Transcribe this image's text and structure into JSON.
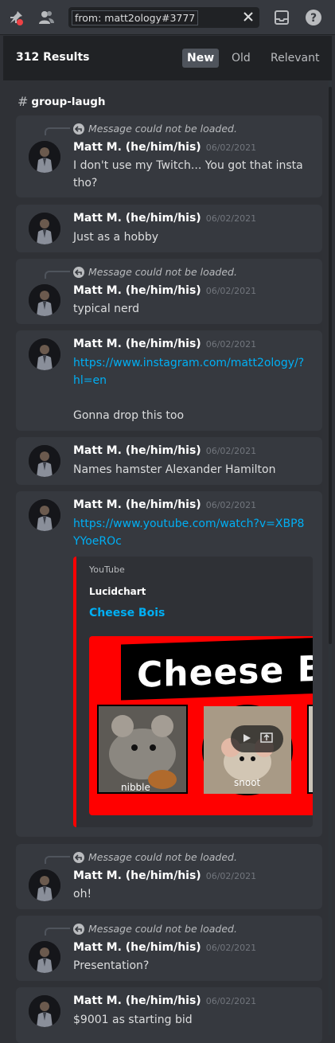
{
  "search": {
    "query": "from: matt2ology#3777"
  },
  "results": {
    "count": "312 Results",
    "sort_new": "New",
    "sort_old": "Old",
    "sort_relevant": "Relevant"
  },
  "channel": {
    "hash": "#",
    "name": "group-laugh"
  },
  "reply_text": "Message could not be loaded.",
  "messages": [
    {
      "author": "Matt M. (he/him/his)",
      "date": "06/02/2021",
      "text": "I don't use my Twitch... You got that insta tho?"
    },
    {
      "author": "Matt M. (he/him/his)",
      "date": "06/02/2021",
      "text": "Just as a hobby"
    },
    {
      "author": "Matt M. (he/him/his)",
      "date": "06/02/2021",
      "text": "typical nerd"
    },
    {
      "author": "Matt M. (he/him/his)",
      "date": "06/02/2021",
      "link": "https://www.instagram.com/matt2ology/?hl=en",
      "text": "Gonna drop this too"
    },
    {
      "author": "Matt M. (he/him/his)",
      "date": "06/02/2021",
      "text": "Names hamster Alexander Hamilton"
    },
    {
      "author": "Matt M. (he/him/his)",
      "date": "06/02/2021",
      "link": "https://www.youtube.com/watch?v=XBP8YYoeROc",
      "embed": {
        "provider": "YouTube",
        "author": "Lucidchart",
        "title": "Cheese Bois",
        "thumb_title": "Cheese Bo",
        "caption_left": "nibble",
        "caption_right": "snoot"
      }
    },
    {
      "author": "Matt M. (he/him/his)",
      "date": "06/02/2021",
      "text": "oh!"
    },
    {
      "author": "Matt M. (he/him/his)",
      "date": "06/02/2021",
      "text": "Presentation?"
    },
    {
      "author": "Matt M. (he/him/his)",
      "date": "06/02/2021",
      "text": "$9001 as starting bid"
    }
  ],
  "colors": {
    "link": "#00aff4",
    "embed_accent": "#ff0000",
    "active_sort": "#4f545c"
  }
}
